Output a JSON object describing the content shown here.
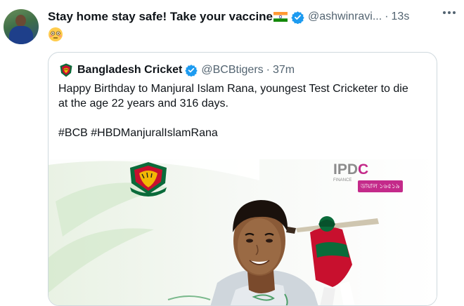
{
  "tweet": {
    "text": "Stay home stay safe! Take your vaccine",
    "handle": "@ashwinravi...",
    "separator": "·",
    "time": "13s"
  },
  "quoted": {
    "name": "Bangladesh Cricket",
    "handle": "@BCBtigers",
    "separator": "·",
    "time": "37m",
    "body_line1": "Happy Birthday to Manjural Islam Rana, youngest Test Cricketer to die",
    "body_line2": "at the age 22 years and 316 days.",
    "hashtags": "#BCB #HBDManjuralIslamRana"
  },
  "media": {
    "sponsor_text_a": "IPD",
    "sponsor_text_b": "C",
    "sponsor_small": "FINANCE",
    "sponsor_sub": "ডায়াল ১৬৫১৯"
  },
  "colors": {
    "text_primary": "#0f1419",
    "text_secondary": "#536471",
    "verified_blue": "#1d9bf0",
    "border": "#cfd9de",
    "sponsor_magenta": "#c42a8a"
  },
  "icons": [
    "avatar",
    "india-flag-emoji",
    "verified-badge-icon",
    "more-icon",
    "flushed-face-emoji",
    "bcb-logo-icon",
    "bcb-crest",
    "player-portrait",
    "batsman-figure"
  ]
}
